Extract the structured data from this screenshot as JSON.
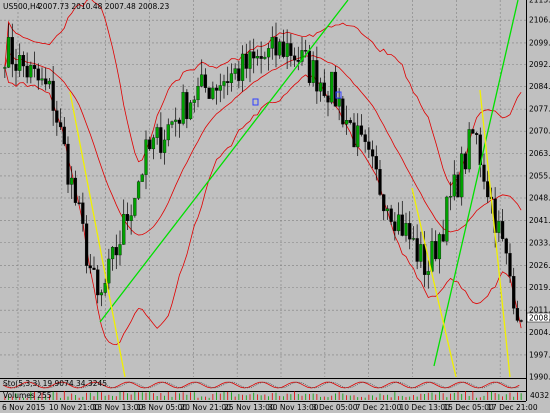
{
  "header": {
    "symbol": "US500,H4",
    "ohlc": "2007.73 2010.48 2007.48 2008.23"
  },
  "indicators": {
    "stoch_label": "Sto(5,3,3) 19.9074 34.3245",
    "volumes_label": "Volumes 255",
    "volume_scale": "4032"
  },
  "price_axis": {
    "ticks": [
      "2113.00",
      "2106.40",
      "2099.00",
      "2092.00",
      "2084.80",
      "2077.40",
      "2070.20",
      "2063.00",
      "2055.60",
      "2048.40",
      "2041.00",
      "2033.80",
      "2026.40",
      "2019.20",
      "2011.80",
      "2004.60",
      "1997.20",
      "1990.00"
    ],
    "current_price": "2008.23"
  },
  "time_axis": {
    "labels": [
      "6 Nov 2015",
      "10 Nov 21:00",
      "13 Nov 13:00",
      "18 Nov 05:00",
      "20 Nov 21:00",
      "25 Nov 13:00",
      "30 Nov 13:00",
      "3 Dec 05:00",
      "7 Dec 21:00",
      "10 Dec 13:00",
      "15 Dec 05:00",
      "17 Dec 21:00"
    ]
  },
  "colors": {
    "background": "#c0c0c0",
    "bull_candle": "#00a000",
    "bear_candle": "#000000",
    "bollinger": "#e00000",
    "trendline_green": "#00e000",
    "trendline_yellow": "#f0f000",
    "current_price_box": "#ffffff"
  },
  "chart_data": {
    "type": "line",
    "title": "US500,H4",
    "ylim": [
      1990.0,
      2113.0
    ],
    "x": [
      "6 Nov 2015",
      "10 Nov 21:00",
      "13 Nov 13:00",
      "18 Nov 05:00",
      "20 Nov 21:00",
      "25 Nov 13:00",
      "30 Nov 13:00",
      "3 Dec 05:00",
      "7 Dec 21:00",
      "10 Dec 13:00",
      "15 Dec 05:00",
      "17 Dec 21:00"
    ],
    "series": [
      {
        "name": "US500,H4",
        "values": [
          2097,
          2082,
          2013,
          2062,
          2082,
          2090,
          2098,
          2083,
          2052,
          2025,
          2070,
          2008.23
        ]
      }
    ],
    "grid": true
  }
}
